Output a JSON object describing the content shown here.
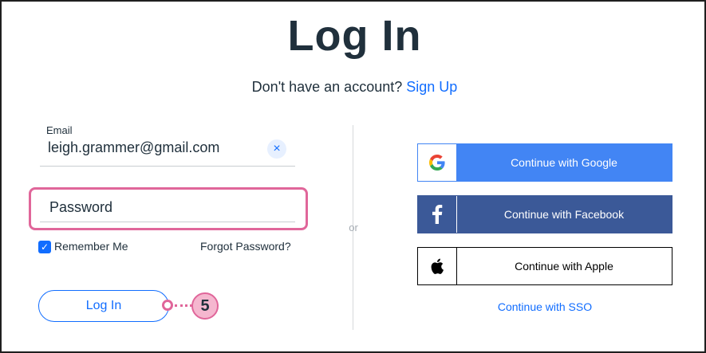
{
  "page": {
    "title": "Log In",
    "signup_prompt": "Don't have an account?",
    "signup_link": "Sign Up"
  },
  "form": {
    "email_label": "Email",
    "email_value": "leigh.grammer@gmail.com",
    "clear_icon": "×",
    "password_placeholder": "Password",
    "remember_label": "Remember Me",
    "remember_checked": true,
    "forgot_label": "Forgot Password?",
    "login_label": "Log In"
  },
  "callout": {
    "number": "5"
  },
  "divider": {
    "or_label": "or"
  },
  "social": {
    "google_label": "Continue with Google",
    "facebook_label": "Continue with Facebook",
    "apple_label": "Continue with Apple",
    "sso_label": "Continue with SSO"
  },
  "colors": {
    "link": "#116dff",
    "highlight": "#e0669a",
    "google": "#4285f4",
    "facebook": "#3b5998",
    "text": "#20303c"
  }
}
